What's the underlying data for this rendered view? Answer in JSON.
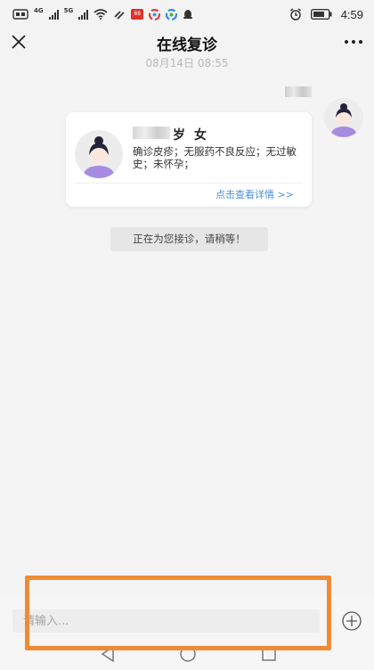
{
  "status_bar": {
    "network_labels": [
      "4G",
      "5G"
    ],
    "time": "4:59",
    "app_badge_label": "88"
  },
  "header": {
    "title": "在线复诊"
  },
  "chat": {
    "timestamp": "08月14日 08:55",
    "patient_card": {
      "age_label": "岁",
      "gender": "女",
      "description": "确诊皮疹；无服药不良反应；无过敏史；未怀孕；",
      "detail_link": "点击查看详情 >>"
    },
    "system_notice": "正在为您接诊，请稍等！"
  },
  "composer": {
    "placeholder": "请输入..."
  },
  "colors": {
    "link": "#4a90d9",
    "highlight_border": "#f08a34",
    "avatar_body": "#a78be0"
  }
}
